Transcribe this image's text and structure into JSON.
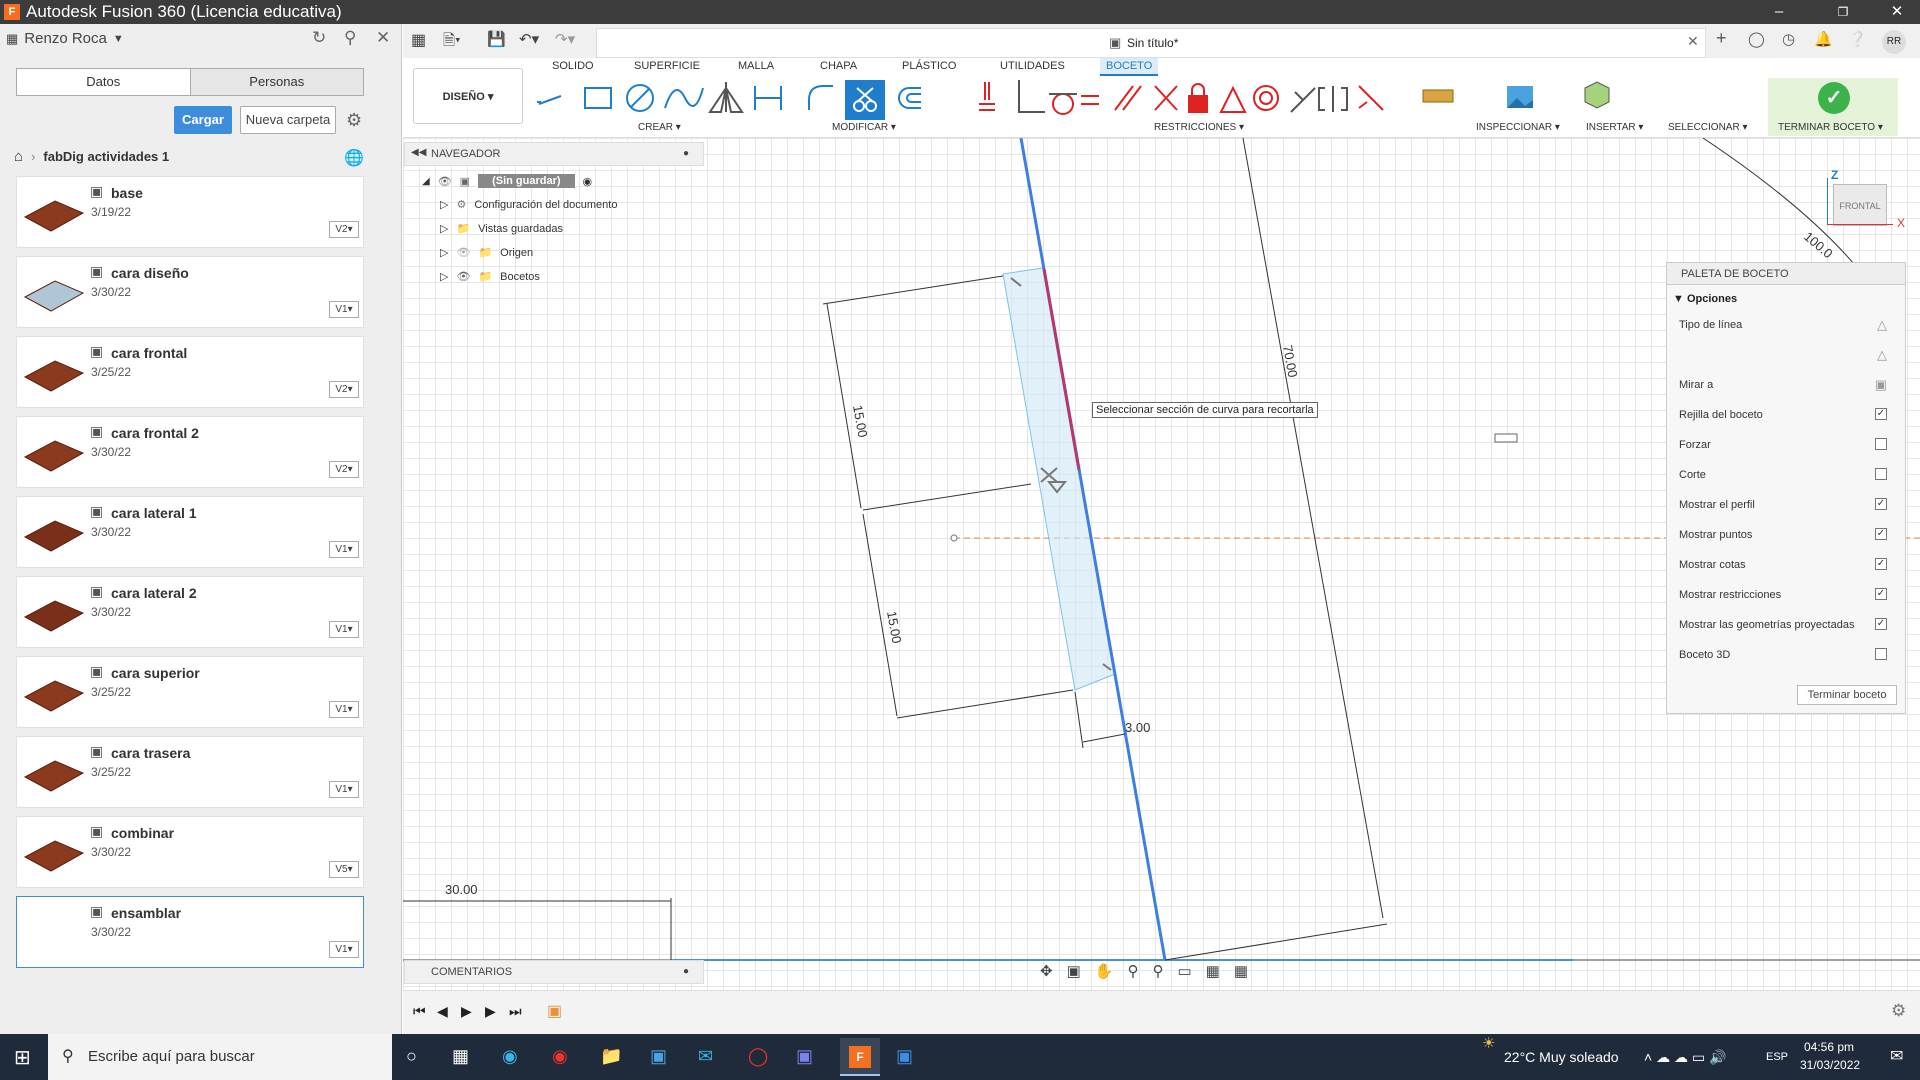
{
  "window": {
    "title": "Autodesk Fusion 360 (Licencia educativa)",
    "logo": "F"
  },
  "left": {
    "user": "Renzo Roca",
    "tabs": [
      "Datos",
      "Personas"
    ],
    "upload_label": "Cargar",
    "new_folder_label": "Nueva carpeta",
    "breadcrumb": "fabDig actividades 1",
    "items": [
      {
        "name": "base",
        "date": "3/19/22",
        "version": "V2"
      },
      {
        "name": "cara diseño",
        "date": "3/30/22",
        "version": "V1"
      },
      {
        "name": "cara frontal",
        "date": "3/25/22",
        "version": "V2"
      },
      {
        "name": "cara frontal 2",
        "date": "3/30/22",
        "version": "V2"
      },
      {
        "name": "cara lateral 1",
        "date": "3/30/22",
        "version": "V1"
      },
      {
        "name": "cara lateral 2",
        "date": "3/30/22",
        "version": "V1"
      },
      {
        "name": "cara superior",
        "date": "3/25/22",
        "version": "V1"
      },
      {
        "name": "cara trasera",
        "date": "3/25/22",
        "version": "V1"
      },
      {
        "name": "combinar",
        "date": "3/30/22",
        "version": "V5"
      },
      {
        "name": "ensamblar",
        "date": "3/30/22",
        "version": "V1"
      }
    ]
  },
  "document": {
    "tab_title": "Sin título*",
    "user_initials": "RR"
  },
  "toolbar": {
    "tabs": [
      "SOLIDO",
      "SUPERFICIE",
      "MALLA",
      "CHAPA",
      "PLÁSTICO",
      "UTILIDADES",
      "BOCETO"
    ],
    "active_tab": "BOCETO",
    "workspace": "DISEÑO ▾",
    "groups": {
      "crear": "CREAR ▾",
      "modificar": "MODIFICAR ▾",
      "restricciones": "RESTRICCIONES ▾",
      "inspeccionar": "INSPECCIONAR ▾",
      "insertar": "INSERTAR ▾",
      "seleccionar": "SELECCIONAR ▾",
      "terminar": "TERMINAR BOCETO ▾"
    }
  },
  "navigator": {
    "title": "NAVEGADOR",
    "root": "(Sin guardar)",
    "rows": [
      "Configuración del documento",
      "Vistas guardadas",
      "Origen",
      "Bocetos"
    ]
  },
  "canvas": {
    "tooltip": "Seleccionar sección de curva para recortarla",
    "dims": {
      "d1": "15.00",
      "d2": "15.00",
      "d3": "3.00",
      "d4": "70.00",
      "d5": "30.00",
      "d6": "100.0"
    },
    "viewcube": {
      "face": "FRONTAL",
      "z": "Z",
      "x": "X"
    }
  },
  "palette": {
    "title": "PALETA DE BOCETO",
    "section": "Opciones",
    "rows": [
      {
        "label": "Tipo de línea",
        "type": "icon"
      },
      {
        "label": "",
        "type": "icon2"
      },
      {
        "label": "Mirar a",
        "type": "icon3"
      },
      {
        "label": "Rejilla del boceto",
        "checked": true
      },
      {
        "label": "Forzar",
        "checked": false
      },
      {
        "label": "Corte",
        "checked": false
      },
      {
        "label": "Mostrar el perfil",
        "checked": true
      },
      {
        "label": "Mostrar puntos",
        "checked": true
      },
      {
        "label": "Mostrar cotas",
        "checked": true
      },
      {
        "label": "Mostrar restricciones",
        "checked": true
      },
      {
        "label": "Mostrar las geometrías proyectadas",
        "checked": true
      },
      {
        "label": "Boceto 3D",
        "checked": false
      }
    ],
    "finish_label": "Terminar boceto"
  },
  "comments": {
    "title": "COMENTARIOS"
  },
  "taskbar": {
    "search_placeholder": "Escribe aquí para buscar",
    "weather": "22°C  Muy soleado",
    "lang": "ESP",
    "time": "04:56 pm",
    "date": "31/03/2022"
  }
}
